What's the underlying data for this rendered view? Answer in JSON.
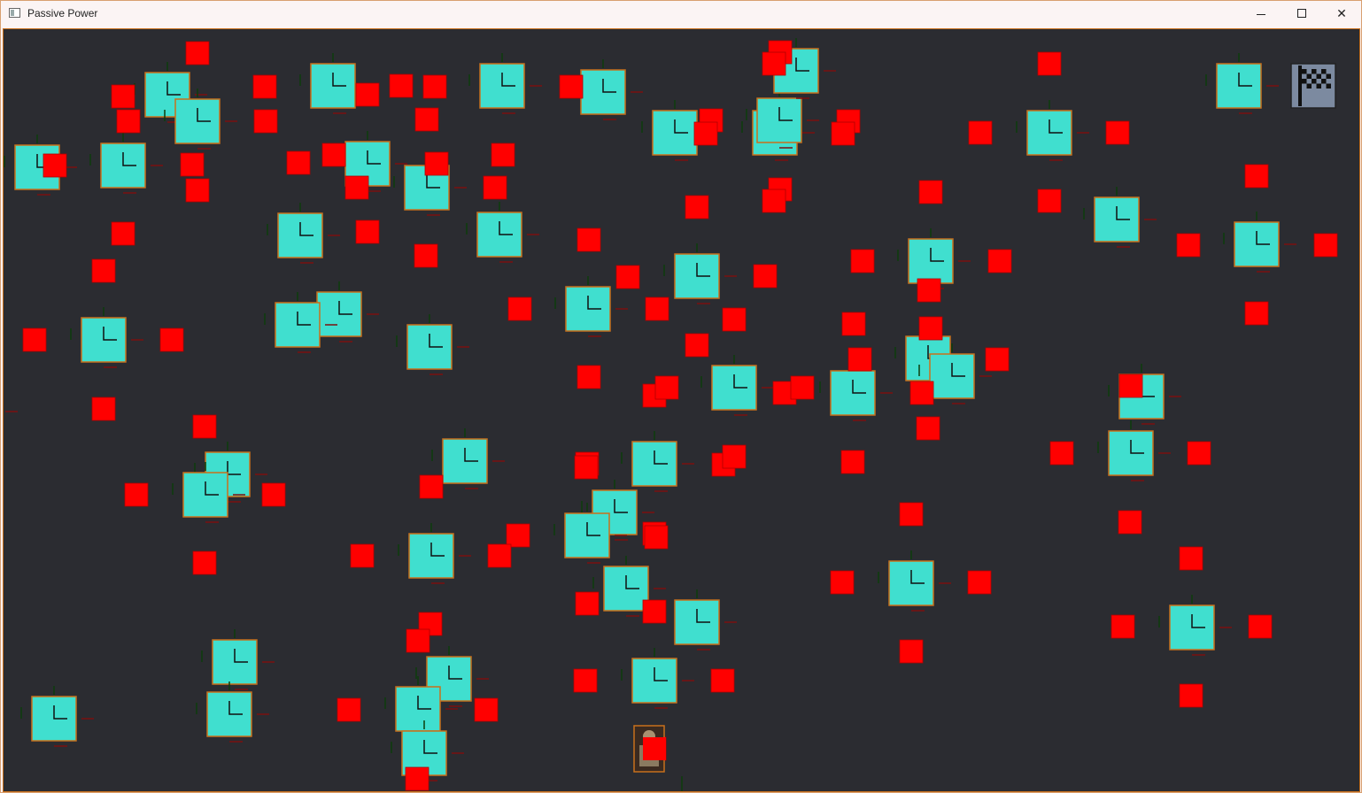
{
  "window": {
    "title": "Passive Power",
    "minimize_icon": "minimize-icon",
    "maximize_icon": "maximize-icon",
    "close_icon": "close-icon"
  },
  "colors": {
    "background": "#2b2c31",
    "tower_fill": "#40dfcf",
    "tower_border": "#c8701c",
    "enemy": "#ff0000",
    "flag_fill": "#7c8aa0",
    "border": "#c8701c"
  },
  "icons": {
    "tower": "tower-icon",
    "enemy": "enemy-block-icon",
    "player": "player-character-icon",
    "goal": "checkered-flag-icon"
  }
}
